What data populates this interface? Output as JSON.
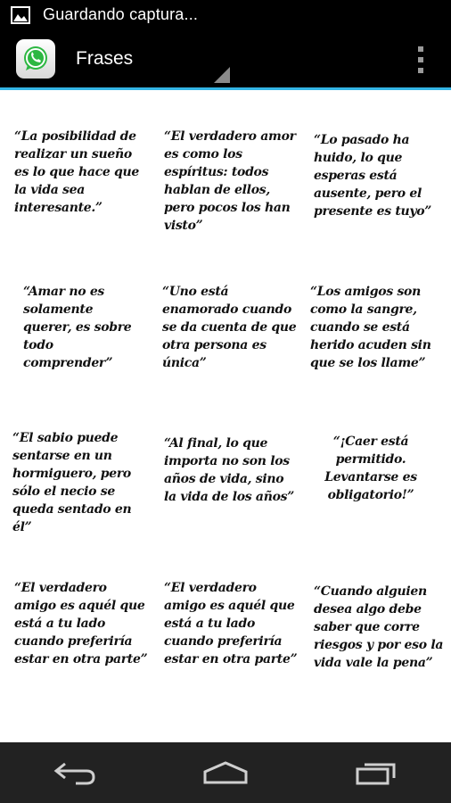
{
  "status": {
    "text": "Guardando captura...",
    "icon": "image-icon"
  },
  "actionbar": {
    "title": "Frases",
    "app_icon": "whatsapp-icon",
    "overflow_icon": "overflow-menu-icon",
    "accent_color": "#33b5e5"
  },
  "quotes": [
    "“La posibilidad de realizar un sueño es lo que hace que la vida sea interesante.”",
    "“El verdadero amor es como los espíritus: todos hablan de ellos, pero pocos los han visto”",
    "“Lo pasado ha huido, lo que esperas está ausente, pero el presente es tuyo”",
    "“Amar no es solamente querer, es sobre todo comprender”",
    "“Uno está enamorado cuando se da cuenta de que otra persona es única”",
    "“Los amigos son como la sangre, cuando se está herido acuden sin que se los llame”",
    "“El sabio puede sentarse en un hormiguero, pero sólo el necio se queda sentado en él”",
    "“Al final, lo que importa no son los años de vida, sino la vida de los años”",
    "“¡Caer está permitido. Levantarse es obligatorio!”",
    "“El verdadero amigo es aquél que está a tu lado cuando preferiría estar en otra parte”",
    "“El verdadero amigo es aquél que está a tu lado cuando preferiría estar en otra parte”",
    "“Cuando alguien desea algo debe saber que corre riesgos y por eso la vida vale la pena”"
  ],
  "navbar": {
    "back_icon": "back-icon",
    "home_icon": "home-icon",
    "recents_icon": "recent-apps-icon"
  }
}
